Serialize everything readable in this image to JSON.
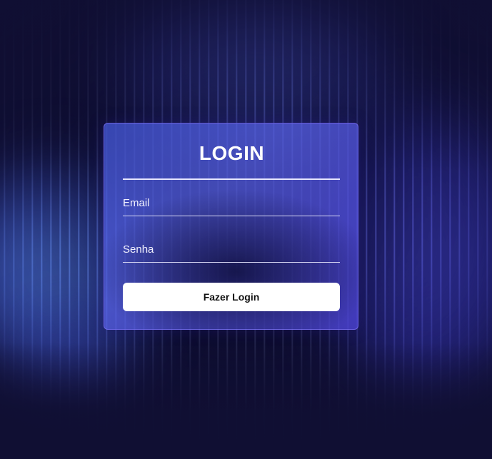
{
  "login": {
    "title": "LOGIN",
    "email_placeholder": "Email",
    "password_placeholder": "Senha",
    "submit_label": "Fazer Login"
  },
  "colors": {
    "background": "#100f33",
    "card_accent": "#5a64e6",
    "button_bg": "#ffffff",
    "button_text": "#111111",
    "text": "#ffffff"
  }
}
